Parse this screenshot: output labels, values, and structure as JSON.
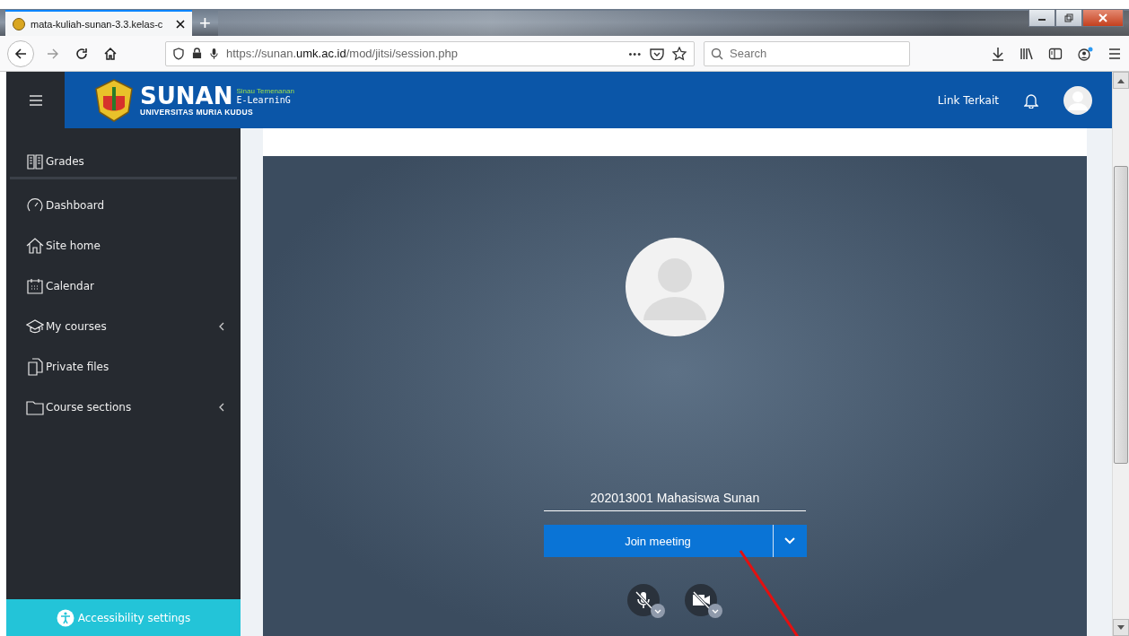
{
  "browser": {
    "tab_title": "mata-kuliah-sunan-3.3.kelas-c",
    "new_tab": "+",
    "url": "https://sunan.**umk.ac.id**/mod/jitsi/session.php",
    "search": {
      "placeholder": "Search"
    },
    "page_actions": "•••"
  },
  "header": {
    "brand": "SUNAN",
    "tagline": "Sinau Temenanan",
    "product": "E-LearninG",
    "university": "UNIVERSITAS MURIA KUDUS",
    "link": "Link Terkait"
  },
  "sidebar": {
    "items": [
      {
        "label": "Grades",
        "expandable": false
      },
      {
        "label": "Dashboard",
        "expandable": false
      },
      {
        "label": "Site home",
        "expandable": false
      },
      {
        "label": "Calendar",
        "expandable": false
      },
      {
        "label": "My courses",
        "expandable": true
      },
      {
        "label": "Private files",
        "expandable": false
      },
      {
        "label": "Course sections",
        "expandable": true
      }
    ],
    "footer": "Accessibility settings"
  },
  "meeting": {
    "display_name": "202013001 Mahasiswa Sunan",
    "join_button": "Join meeting",
    "devices": [
      {
        "kind": "microphone",
        "off": true
      },
      {
        "kind": "camera",
        "off": true
      }
    ]
  }
}
